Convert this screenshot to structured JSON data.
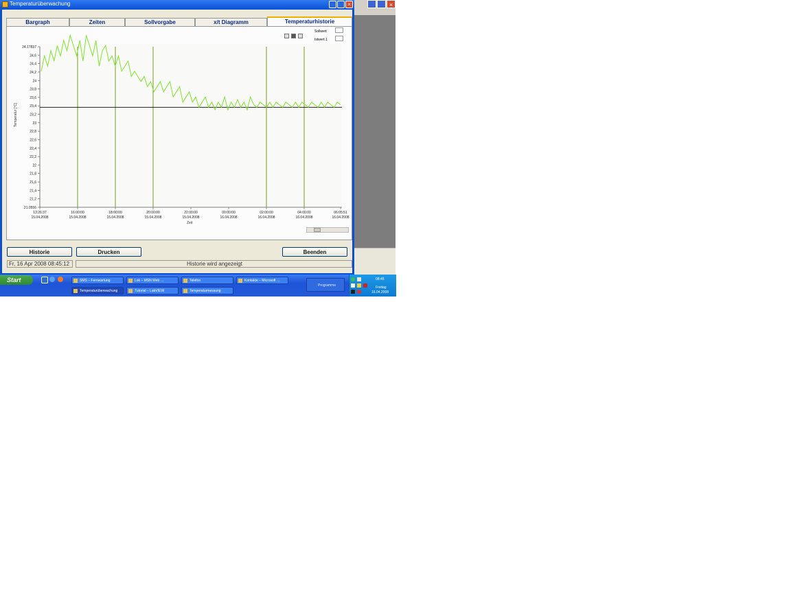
{
  "window": {
    "title": "Temperaturüberwachung"
  },
  "tabs": [
    {
      "label": "Bargraph",
      "active": false
    },
    {
      "label": "Zeiten",
      "active": false
    },
    {
      "label": "Sollvorgabe",
      "active": false
    },
    {
      "label": "x/t Diagramm",
      "active": false
    },
    {
      "label": "Temperaturhistorie",
      "active": true
    }
  ],
  "chart_data": {
    "type": "line",
    "ylabel": "Temperatur [°C]",
    "xlabel": "Zeit",
    "ylim": [
      21.0556,
      24.17837
    ],
    "y_ticks": [
      "24.17837",
      "24,6",
      "24,4",
      "24,2",
      "24",
      "23,8",
      "23,6",
      "23,4",
      "23,2",
      "23",
      "22,8",
      "22,6",
      "22,4",
      "22,2",
      "22",
      "21,8",
      "21,6",
      "21,4",
      "21,2",
      "21.0556"
    ],
    "x_ticks": [
      {
        "time": "13:26:37",
        "date": "15.04.2008"
      },
      {
        "time": "16:00:00",
        "date": "15.04.2008"
      },
      {
        "time": "18:00:00",
        "date": "15.04.2008"
      },
      {
        "time": "20:00:00",
        "date": "15.04.2008"
      },
      {
        "time": "22:00:00",
        "date": "15.04.2008"
      },
      {
        "time": "00:00:00",
        "date": "16.04.2008"
      },
      {
        "time": "02:00:00",
        "date": "16.04.2008"
      },
      {
        "time": "04:00:00",
        "date": "16.04.2008"
      },
      {
        "time": "06:05:51",
        "date": "16.04.2008"
      }
    ],
    "legend": [
      "Sollwert",
      "Istwert 1"
    ],
    "series": [
      {
        "name": "Sollwert",
        "color": "#000000",
        "values": [
          23,
          23
        ]
      },
      {
        "name": "Istwert 1",
        "color": "#7fe52a",
        "values": [
          23.7,
          24.0,
          23.8,
          24.1,
          23.9,
          24.2,
          24.0,
          24.3,
          24.1,
          24.4,
          24.2,
          24.0,
          24.3,
          23.9,
          24.4,
          24.2,
          24.0,
          24.3,
          23.8,
          24.1,
          24.2,
          23.9,
          24.0,
          23.8,
          24.0,
          23.7,
          23.8,
          23.9,
          23.6,
          23.7,
          23.6,
          23.5,
          23.6,
          23.4,
          23.5,
          23.3,
          23.4,
          23.5,
          23.3,
          23.4,
          23.5,
          23.2,
          23.3,
          23.4,
          23.1,
          23.2,
          23.3,
          23.1,
          23.2,
          23.0,
          23.1,
          23.2,
          23.0,
          23.1,
          22.95,
          23.1,
          23.0,
          23.2,
          22.95,
          23.1,
          23.0,
          23.15,
          23.0,
          23.1,
          22.95,
          23.2,
          23.05,
          23.0,
          23.1,
          23.05,
          23.0,
          23.1,
          23.0,
          23.1,
          23.05,
          23.0,
          23.1,
          23.05,
          23.0,
          23.1,
          23.0,
          23.1,
          23.05,
          23.0,
          23.1,
          23.05,
          23.0,
          23.1,
          23.0,
          23.1,
          23.05,
          23.0,
          23.1,
          23.05
        ]
      }
    ],
    "vertical_markers": [
      "16:00:00",
      "18:00:00",
      "20:00:00",
      "02:00:00",
      "04:00:00"
    ],
    "grid": false,
    "legend_position": "top-right"
  },
  "buttons": {
    "history": "Historie",
    "print": "Drucken",
    "quit": "Beenden"
  },
  "status": {
    "datetime": "Fr, 16 Apr 2008 08:45:12",
    "message": "Historie wird angezeigt"
  },
  "taskbar": {
    "start": "Start",
    "tasks": [
      "SMS – Fernwartung",
      "Lok – MSN Web …",
      "Telefon",
      "Kontakte – Microsoft …",
      "Temperaturüberwachung",
      "Tutorial – LabVIEW",
      "Temperaturmessung"
    ],
    "programs": "Programme",
    "clock_time": "08:45",
    "clock_day": "Freitag",
    "clock_date": "16.04.2008"
  },
  "colors": {
    "titlebar": "#0a4fd6",
    "series_ist": "#7fe52a",
    "markers": "#7c9b1a"
  }
}
